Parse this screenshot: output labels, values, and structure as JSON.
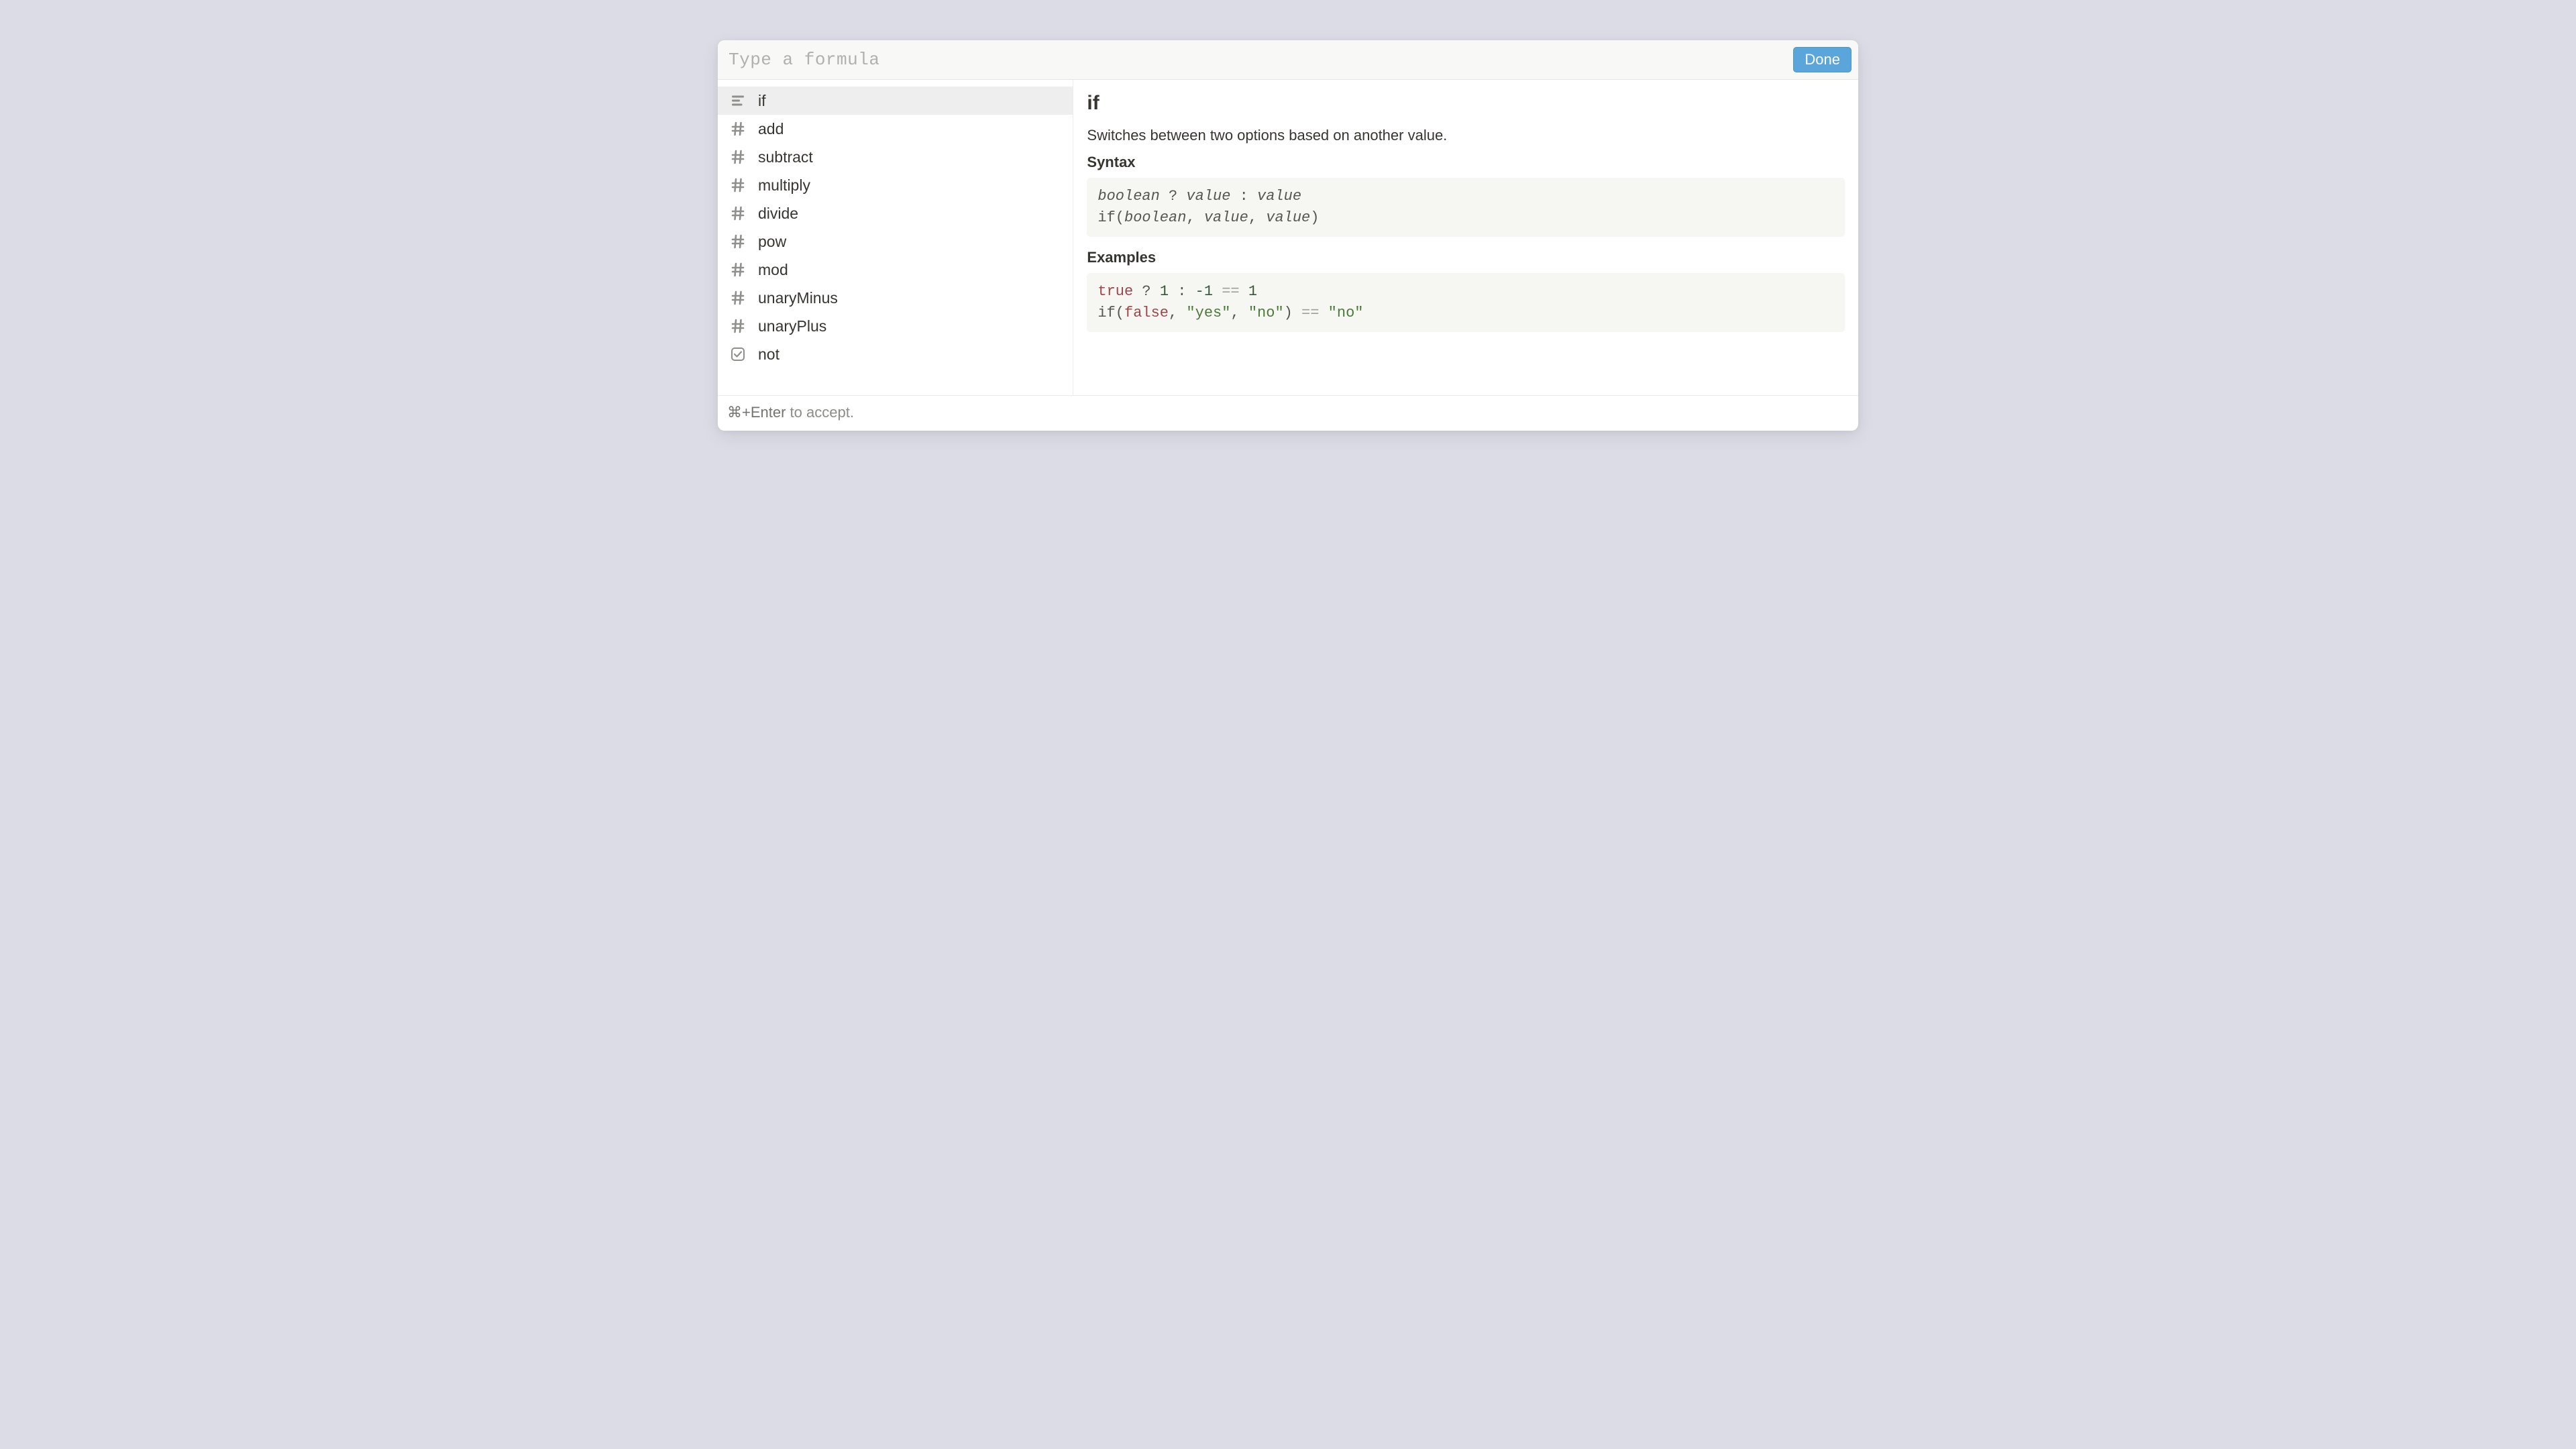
{
  "topbar": {
    "placeholder": "Type a formula",
    "value": "",
    "done_label": "Done"
  },
  "sidebar": {
    "items": [
      {
        "label": "if",
        "icon": "text",
        "selected": true
      },
      {
        "label": "add",
        "icon": "number",
        "selected": false
      },
      {
        "label": "subtract",
        "icon": "number",
        "selected": false
      },
      {
        "label": "multiply",
        "icon": "number",
        "selected": false
      },
      {
        "label": "divide",
        "icon": "number",
        "selected": false
      },
      {
        "label": "pow",
        "icon": "number",
        "selected": false
      },
      {
        "label": "mod",
        "icon": "number",
        "selected": false
      },
      {
        "label": "unaryMinus",
        "icon": "number",
        "selected": false
      },
      {
        "label": "unaryPlus",
        "icon": "number",
        "selected": false
      },
      {
        "label": "not",
        "icon": "boolean",
        "selected": false
      }
    ]
  },
  "detail": {
    "title": "if",
    "description": "Switches between two options based on another value.",
    "syntax_heading": "Syntax",
    "syntax_lines": [
      [
        {
          "t": "boolean",
          "k": "type"
        },
        {
          "t": " ? "
        },
        {
          "t": "value",
          "k": "type"
        },
        {
          "t": " : "
        },
        {
          "t": "value",
          "k": "type"
        }
      ],
      [
        {
          "t": "if("
        },
        {
          "t": "boolean",
          "k": "type"
        },
        {
          "t": ", "
        },
        {
          "t": "value",
          "k": "type"
        },
        {
          "t": ", "
        },
        {
          "t": "value",
          "k": "type"
        },
        {
          "t": ")"
        }
      ]
    ],
    "examples_heading": "Examples",
    "example_lines": [
      [
        {
          "t": "true",
          "k": "kw"
        },
        {
          "t": " ? "
        },
        {
          "t": "1",
          "k": "num"
        },
        {
          "t": " : "
        },
        {
          "t": "-1",
          "k": "num"
        },
        {
          "t": " == ",
          "k": "op"
        },
        {
          "t": "1",
          "k": "num"
        }
      ],
      [
        {
          "t": "if("
        },
        {
          "t": "false",
          "k": "kw"
        },
        {
          "t": ", "
        },
        {
          "t": "\"yes\"",
          "k": "str"
        },
        {
          "t": ", "
        },
        {
          "t": "\"no\"",
          "k": "str"
        },
        {
          "t": ")"
        },
        {
          "t": " == ",
          "k": "op"
        },
        {
          "t": "\"no\"",
          "k": "str"
        }
      ]
    ]
  },
  "footer": {
    "kbd": "⌘+Enter",
    "suffix": " to accept."
  }
}
